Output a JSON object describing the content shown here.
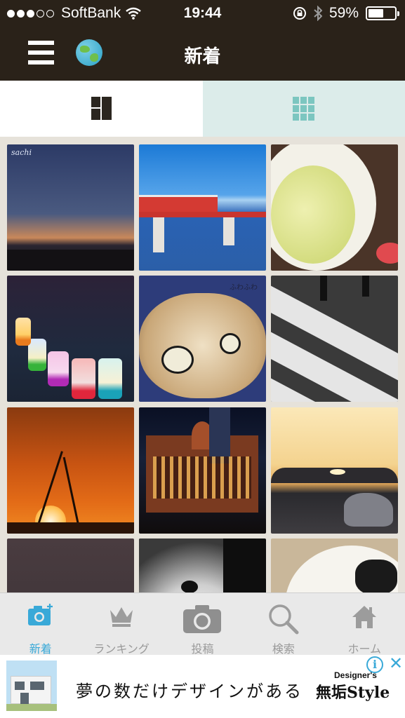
{
  "status_bar": {
    "carrier": "SoftBank",
    "signal_bars": 3,
    "time": "19:44",
    "battery_percent": "59%",
    "battery_level": 0.59
  },
  "nav": {
    "title": "新着",
    "menu_icon": "hamburger-menu-icon",
    "globe_icon": "globe-icon"
  },
  "view_toggle": {
    "active": "mosaic",
    "options": [
      "mosaic-layout-icon",
      "grid-layout-icon"
    ]
  },
  "photos": [
    {
      "caption": "sachi",
      "subject": "dusk sky over town"
    },
    {
      "caption": "",
      "subject": "red train on bridge over river"
    },
    {
      "caption": "",
      "subject": "dessert in white bowl with spoon"
    },
    {
      "caption": "",
      "subject": "row of colorful candles"
    },
    {
      "caption": "ふわふわ",
      "subject": "fluffy creature with eyes"
    },
    {
      "caption": "",
      "subject": "crosswalk with silhouette legs"
    },
    {
      "caption": "",
      "subject": "sunset with plant silhouette"
    },
    {
      "caption": "",
      "subject": "red brick station at night"
    },
    {
      "caption": "",
      "subject": "sunset over sea and rocks"
    },
    {
      "caption": "",
      "subject": "gray surface"
    },
    {
      "caption": "",
      "subject": "monochrome abstract"
    },
    {
      "caption": "",
      "subject": "cat on plate"
    }
  ],
  "tabbar": {
    "items": [
      {
        "label": "新着",
        "icon": "camera-plus-icon",
        "active": true
      },
      {
        "label": "ランキング",
        "icon": "crown-icon",
        "active": false
      },
      {
        "label": "投稿",
        "icon": "camera-icon",
        "active": false
      },
      {
        "label": "検索",
        "icon": "search-icon",
        "active": false
      },
      {
        "label": "ホーム",
        "icon": "home-icon",
        "active": false
      }
    ]
  },
  "ad": {
    "copy": "夢の数だけデザインがある",
    "brand_top": "Designer's",
    "brand": "無垢Style",
    "info_glyph": "i",
    "close_glyph": "✕"
  },
  "colors": {
    "header_bg": "#2a2219",
    "accent_blue": "#39a9d8",
    "toggle_inactive_bg": "#dcecea",
    "grid_icon": "#7cc6c0"
  }
}
